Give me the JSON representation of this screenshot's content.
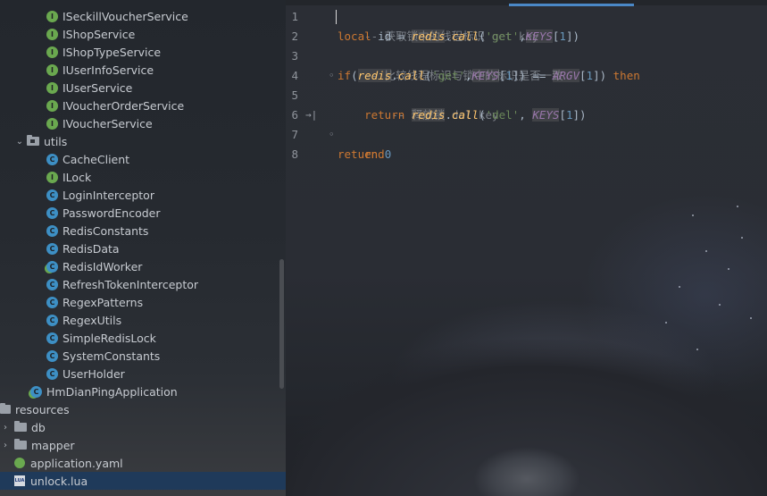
{
  "tree": {
    "rows": [
      {
        "label": "ISeckillVoucherService",
        "icon": "interface-icon"
      },
      {
        "label": "IShopService",
        "icon": "interface-icon"
      },
      {
        "label": "IShopTypeService",
        "icon": "interface-icon"
      },
      {
        "label": "IUserInfoService",
        "icon": "interface-icon"
      },
      {
        "label": "IUserService",
        "icon": "interface-icon"
      },
      {
        "label": "IVoucherOrderService",
        "icon": "interface-icon"
      },
      {
        "label": "IVoucherService",
        "icon": "interface-icon"
      },
      {
        "label": "utils",
        "icon": "package-folder-icon"
      },
      {
        "label": "CacheClient",
        "icon": "class-icon"
      },
      {
        "label": "ILock",
        "icon": "interface-icon"
      },
      {
        "label": "LoginInterceptor",
        "icon": "class-icon"
      },
      {
        "label": "PasswordEncoder",
        "icon": "class-icon"
      },
      {
        "label": "RedisConstants",
        "icon": "class-icon"
      },
      {
        "label": "RedisData",
        "icon": "class-icon"
      },
      {
        "label": "RedisIdWorker",
        "icon": "spring-class-icon"
      },
      {
        "label": "RefreshTokenInterceptor",
        "icon": "class-icon"
      },
      {
        "label": "RegexPatterns",
        "icon": "class-icon"
      },
      {
        "label": "RegexUtils",
        "icon": "class-icon"
      },
      {
        "label": "SimpleRedisLock",
        "icon": "class-icon"
      },
      {
        "label": "SystemConstants",
        "icon": "class-icon"
      },
      {
        "label": "UserHolder",
        "icon": "class-icon"
      },
      {
        "label": "HmDianPingApplication",
        "icon": "spring-class-icon"
      },
      {
        "label": "resources",
        "icon": "folder-icon"
      },
      {
        "label": "db",
        "icon": "folder-icon"
      },
      {
        "label": "mapper",
        "icon": "folder-icon"
      },
      {
        "label": "application.yaml",
        "icon": "yaml-icon"
      },
      {
        "label": "unlock.lua",
        "icon": "lua-icon"
      }
    ],
    "icon_letters": {
      "interface": "I",
      "class": "C",
      "lua": "LUA"
    }
  },
  "editor": {
    "line_numbers": [
      "1",
      "2",
      "3",
      "4",
      "5",
      "6",
      "7",
      "8"
    ],
    "lines": {
      "l1": "-- 获取锁中的线程标识 get key",
      "l2": {
        "kw": "local",
        "var": " id = ",
        "call": "redis",
        "dot": ".",
        "fn": "call",
        "p1": "(",
        "s": "'get'",
        "c": ",",
        "g": "KEYS",
        "b1": "[",
        "n": "1",
        "b2": "])"
      },
      "l3": "-- 比较线程标识与锁中的标识是否一致",
      "l4": {
        "kw1": "if",
        "p0": "(",
        "call": "redis",
        "dot": ".",
        "fn": "call",
        "p1": "(",
        "s": "'get'",
        "c": ",",
        "g": "KEYS",
        "b1": "[",
        "n": "1",
        "b2": "]) == ",
        "g2": "ARGV",
        "b3": "[",
        "n2": "1",
        "b4": "]) ",
        "kw2": "then"
      },
      "l5": "    -- 释放锁 del key",
      "l6": {
        "indent": "    ",
        "kw": "return",
        "sp": " ",
        "call": "redis",
        "dot": ".",
        "fn": "call",
        "p1": "(",
        "s": "'del'",
        "c": ", ",
        "g": "KEYS",
        "b1": "[",
        "n": "1",
        "b2": "])"
      },
      "l7": "end",
      "l8": {
        "kw": "return",
        "sp": " ",
        "n": "0"
      }
    }
  },
  "colors": {
    "keyword": "#cc7832",
    "comment": "#7a7f86",
    "string": "#6a8759",
    "number": "#6897bb",
    "function": "#ffc66d",
    "global": "#9876aa",
    "selection": "#1f3a5a"
  }
}
